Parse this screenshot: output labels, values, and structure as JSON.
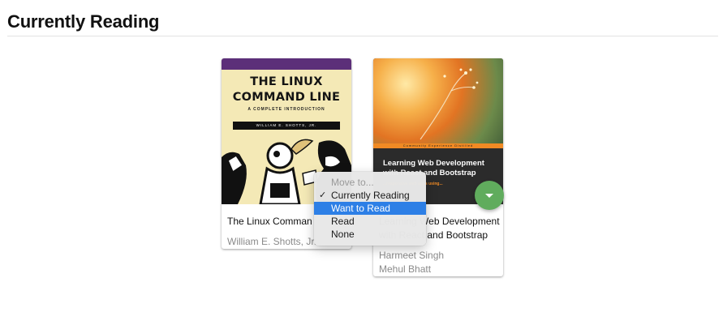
{
  "shelf": {
    "title": "Currently Reading"
  },
  "books": [
    {
      "title": "The Linux Command Line",
      "authors": [
        "William E. Shotts, Jr."
      ],
      "cover": {
        "line1": "THE LINUX",
        "line2": "COMMAND LINE",
        "subtitle": "A COMPLETE INTRODUCTION",
        "author_bar": "WILLIAM E. SHOTTS, JR."
      }
    },
    {
      "title": "Learning Web Development with React and Bootstrap",
      "authors": [
        "Harmeet Singh",
        "Mehul Bhatt"
      ],
      "cover": {
        "stripe": "Community Experience Distilled",
        "title": "Learning Web Development with React and Bootstrap",
        "tagline": "...responsive web apps using..."
      }
    }
  ],
  "move_menu": {
    "options": [
      {
        "label": "Move to...",
        "disabled": true
      },
      {
        "label": "Currently Reading",
        "checked": true
      },
      {
        "label": "Want to Read",
        "highlighted": true
      },
      {
        "label": "Read"
      },
      {
        "label": "None"
      }
    ]
  },
  "colors": {
    "fab": "#60ac5d",
    "menu_highlight": "#2d7fe6",
    "linux_band": "#5c2f79"
  },
  "icons": {
    "fab": "chevron-down-icon",
    "check": "checkmark-icon"
  }
}
